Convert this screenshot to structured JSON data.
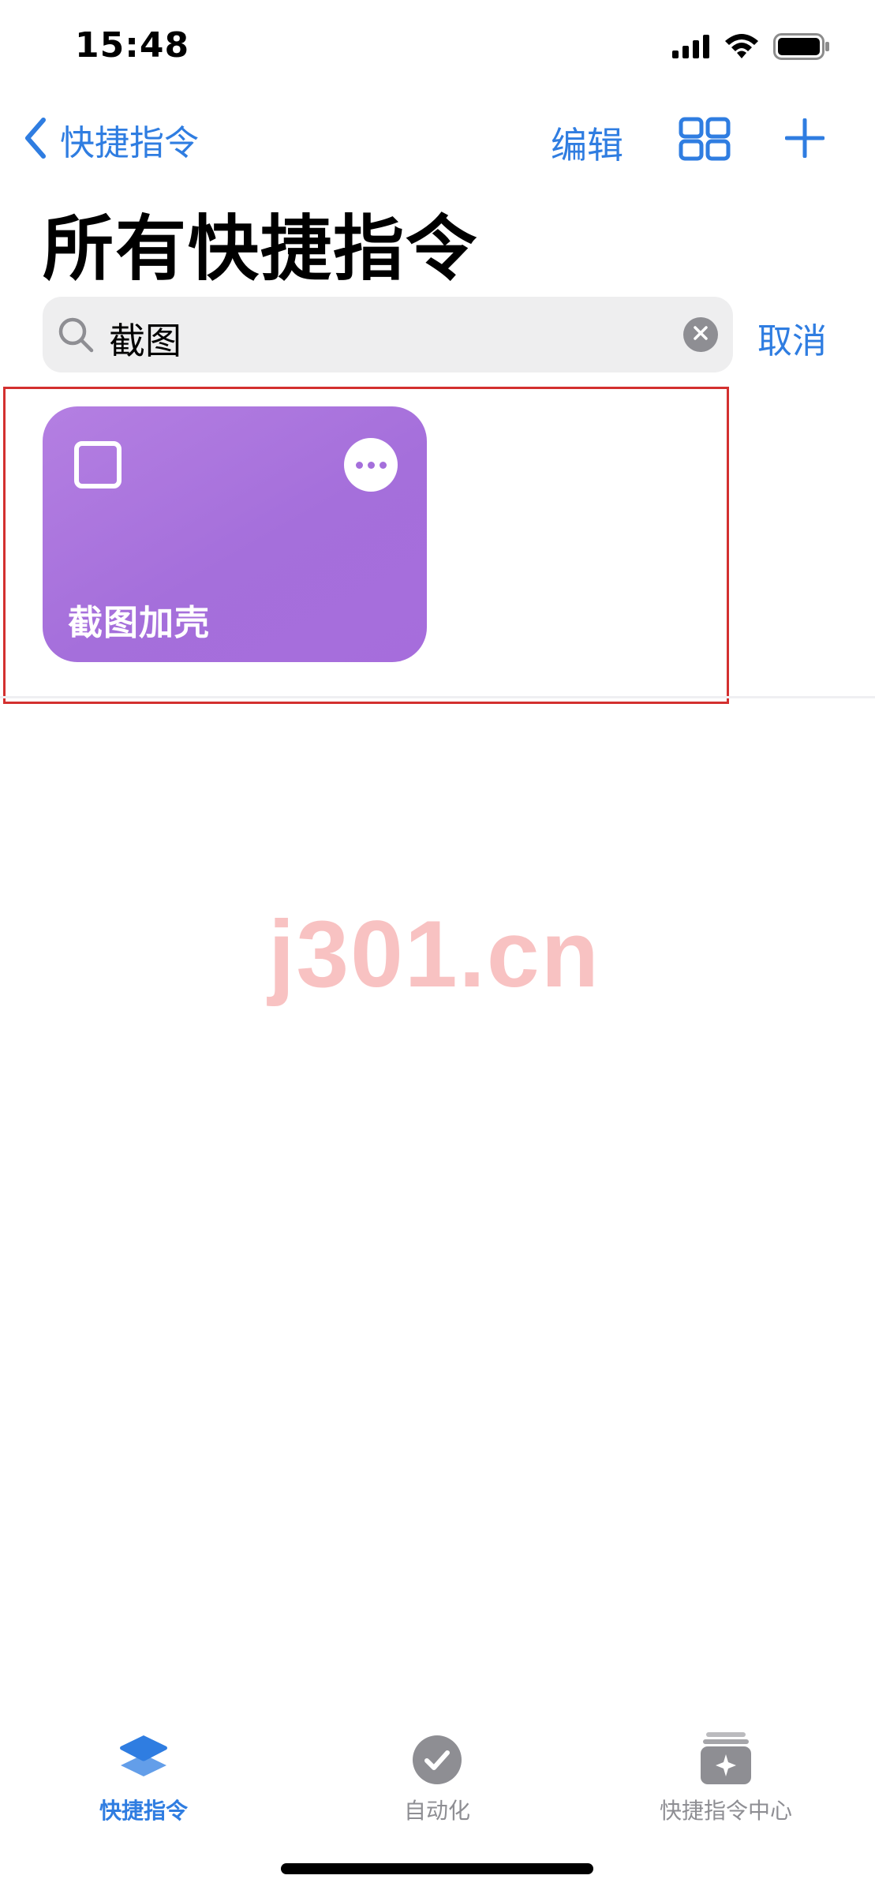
{
  "status_bar": {
    "time": "15:48"
  },
  "nav": {
    "back_label": "快捷指令",
    "edit_label": "编辑"
  },
  "page_title": "所有快捷指令",
  "search": {
    "value": "截图",
    "cancel_label": "取消"
  },
  "results": [
    {
      "name": "截图加壳",
      "color": "#a972dd"
    }
  ],
  "watermark": "j301.cn",
  "tab_bar": {
    "items": [
      {
        "label": "快捷指令",
        "icon": "layers-icon",
        "active": true,
        "color": "#2f7de1"
      },
      {
        "label": "自动化",
        "icon": "clock-check-icon",
        "active": false,
        "color": "#8e8e93"
      },
      {
        "label": "快捷指令中心",
        "icon": "gallery-icon",
        "active": false,
        "color": "#8e8e93"
      }
    ]
  },
  "colors": {
    "accent": "#2f7de1",
    "highlight_border": "#d3302f",
    "search_bg": "#eeeeef"
  }
}
